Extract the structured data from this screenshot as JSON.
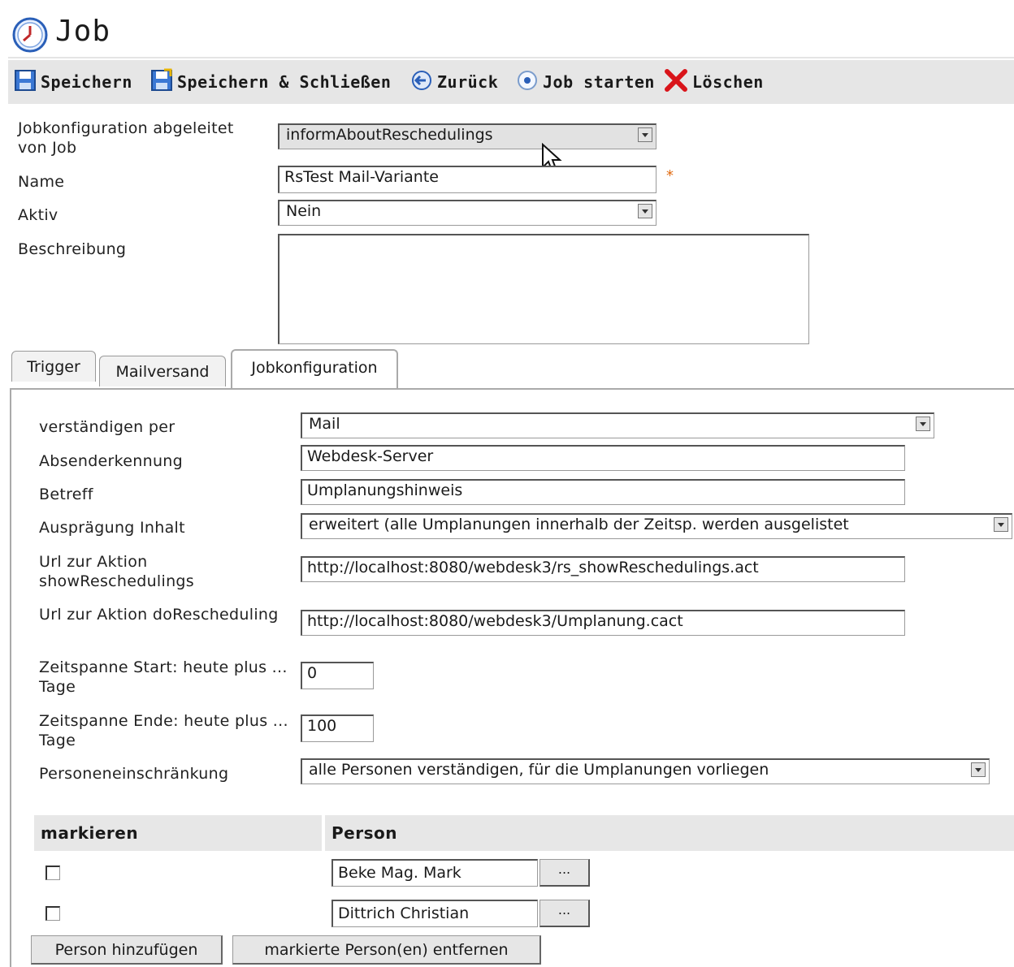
{
  "window": {
    "title": "Job"
  },
  "toolbar": {
    "save": "Speichern",
    "save_close": "Speichern & Schließen",
    "back": "Zurück",
    "start": "Job starten",
    "delete": "Löschen"
  },
  "form": {
    "derived_label": "Jobkonfiguration abgeleitet von Job",
    "derived_value": "informAboutReschedulings",
    "name_label": "Name",
    "name_value": "RsTest Mail-Variante",
    "required_mark": "*",
    "active_label": "Aktiv",
    "active_value": "Nein",
    "description_label": "Beschreibung",
    "description_value": ""
  },
  "tabs": [
    {
      "label": "Trigger"
    },
    {
      "label": "Mailversand"
    },
    {
      "label": "Jobkonfiguration"
    }
  ],
  "jobconfig": {
    "notify_label": "verständigen per",
    "notify_value": "Mail",
    "sender_label": "Absenderkennung",
    "sender_value": "Webdesk-Server",
    "subject_label": "Betreff",
    "subject_value": "Umplanungshinweis",
    "content_label": "Ausprägung Inhalt",
    "content_value": "erweitert (alle Umplanungen innerhalb der Zeitsp. werden ausgelistet",
    "url_show_label": "Url zur Aktion showReschedulings",
    "url_show_value": "http://localhost:8080/webdesk3/rs_showReschedulings.act",
    "url_do_label": "Url zur Aktion doRescheduling",
    "url_do_value": "http://localhost:8080/webdesk3/Umplanung.cact",
    "start_label": "Zeitspanne Start: heute plus ... Tage",
    "start_value": "0",
    "end_label": "Zeitspanne Ende: heute plus ... Tage",
    "end_value": "100",
    "persons_label": "Personeneinschränkung",
    "persons_value": "alle Personen verständigen, für die Umplanungen vorliegen"
  },
  "persons_table": {
    "col_mark": "markieren",
    "col_person": "Person",
    "rows": [
      {
        "person": "Beke Mag. Mark",
        "picker": "..."
      },
      {
        "person": "Dittrich Christian",
        "picker": "..."
      }
    ],
    "add_button": "Person hinzufügen",
    "remove_button": "markierte Person(en) entfernen"
  }
}
